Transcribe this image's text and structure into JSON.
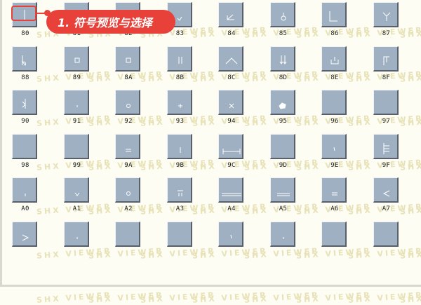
{
  "watermark": "SHX VIEWER",
  "callout": {
    "text": "1. 符号预览与选择"
  },
  "colors": {
    "tile": "#9fb0c3",
    "accent": "#e8413a",
    "background": "#fdfdf3",
    "glyph": "#ffffff"
  },
  "symbols": [
    {
      "code": "80",
      "icon": "vertical-stroke-glyph"
    },
    {
      "code": "81",
      "icon": "blank-glyph"
    },
    {
      "code": "82",
      "icon": "blank-glyph"
    },
    {
      "code": "83",
      "icon": "small-check-glyph"
    },
    {
      "code": "84",
      "icon": "angle-glyph"
    },
    {
      "code": "85",
      "icon": "small-circle-stem-glyph"
    },
    {
      "code": "86",
      "icon": "corner-l-glyph"
    },
    {
      "code": "87",
      "icon": "y-fork-glyph"
    },
    {
      "code": "88",
      "icon": "flat-note-glyph"
    },
    {
      "code": "89",
      "icon": "small-square-glyph"
    },
    {
      "code": "8A",
      "icon": "small-square-glyph"
    },
    {
      "code": "8B",
      "icon": "double-bar-glyph"
    },
    {
      "code": "8C",
      "icon": "caret-glyph"
    },
    {
      "code": "8D",
      "icon": "down-arrows-glyph"
    },
    {
      "code": "8E",
      "icon": "cup-glyph"
    },
    {
      "code": "8F",
      "icon": "bracket-bars-glyph"
    },
    {
      "code": "90",
      "icon": "sigma-stroke-glyph"
    },
    {
      "code": "91",
      "icon": "tiny-dot-glyph"
    },
    {
      "code": "92",
      "icon": "small-ring-glyph"
    },
    {
      "code": "93",
      "icon": "plus-glyph"
    },
    {
      "code": "94",
      "icon": "times-glyph"
    },
    {
      "code": "95",
      "icon": "filled-pentagon-glyph"
    },
    {
      "code": "96",
      "icon": "blank-glyph"
    },
    {
      "code": "97",
      "icon": "blank-glyph"
    },
    {
      "code": "98",
      "icon": "blank-glyph"
    },
    {
      "code": "99",
      "icon": "blank-glyph"
    },
    {
      "code": "9A",
      "icon": "equals-glyph"
    },
    {
      "code": "9B",
      "icon": "short-bar-glyph"
    },
    {
      "code": "9C",
      "icon": "dimension-line-glyph"
    },
    {
      "code": "9D",
      "icon": "blank-glyph"
    },
    {
      "code": "9E",
      "icon": "tick-glyph"
    },
    {
      "code": "9F",
      "icon": "e-comb-glyph"
    },
    {
      "code": "A0",
      "icon": "tiny-bar-glyph"
    },
    {
      "code": "A1",
      "icon": "small-v-glyph"
    },
    {
      "code": "A2",
      "icon": "small-ring-glyph"
    },
    {
      "code": "A3",
      "icon": "stacked-marks-glyph"
    },
    {
      "code": "A4",
      "icon": "long-double-line-glyph"
    },
    {
      "code": "A5",
      "icon": "double-line-glyph"
    },
    {
      "code": "A6",
      "icon": "equals-glyph"
    },
    {
      "code": "A7",
      "icon": "less-than-glyph"
    },
    {
      "code": "",
      "icon": "greater-than-glyph"
    },
    {
      "code": "",
      "icon": "tiny-dot-glyph"
    },
    {
      "code": "",
      "icon": "blank-glyph"
    },
    {
      "code": "",
      "icon": "blank-glyph"
    },
    {
      "code": "",
      "icon": "tick-glyph"
    },
    {
      "code": "",
      "icon": "tiny-dot-glyph"
    },
    {
      "code": "",
      "icon": "blank-glyph"
    },
    {
      "code": "",
      "icon": "blank-glyph"
    }
  ]
}
